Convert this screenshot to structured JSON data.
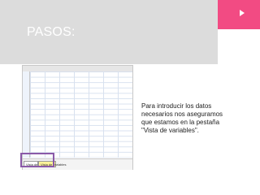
{
  "slide": {
    "title": "PASOS:",
    "caption": "Para introducir los datos necesarios nos aseguramos que estamos en la pestaña \"Vista de variables\".",
    "colors": {
      "header_bg": "#dcdcdc",
      "accent": "#f24b83",
      "highlight_border": "#8b5aa8",
      "active_tab": "#fff39a"
    }
  },
  "spreadsheet": {
    "row_numbers": [
      "1",
      "2",
      "3",
      "4",
      "5",
      "6",
      "7",
      "8",
      "9",
      "10",
      "11",
      "12",
      "13",
      "14",
      "15",
      "16"
    ],
    "tabs": [
      "Vista de datos",
      "Vista de variables"
    ]
  },
  "icons": {
    "menu": "play-triangle-icon"
  }
}
